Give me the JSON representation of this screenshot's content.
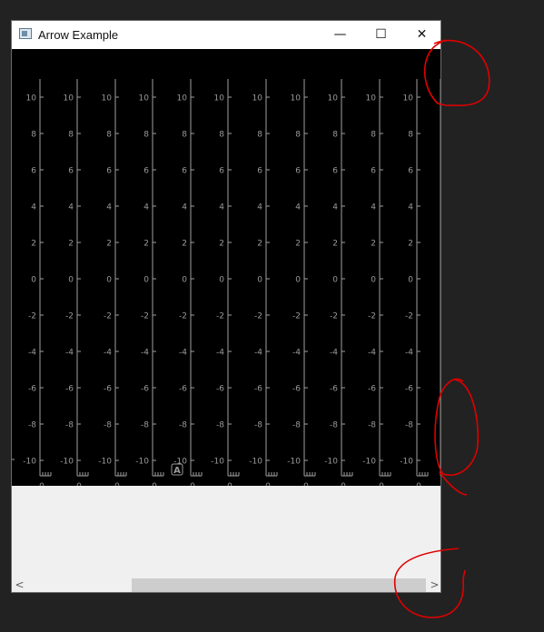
{
  "window": {
    "title": "Arrow Example",
    "controls": {
      "minimize": "—",
      "maximize": "☐",
      "close": "✕"
    }
  },
  "plot": {
    "y_tick_labels": [
      "10",
      "8",
      "6",
      "4",
      "2",
      "0",
      "-2",
      "-4",
      "-6",
      "-8",
      "-10"
    ],
    "x_tick_label": "0",
    "marker_label": "A",
    "axis_color": "#a0a0a0",
    "label_color": "#9a9a9a",
    "background": "#000000"
  },
  "scrollbar": {
    "left_arrow": "<",
    "right_arrow": ">"
  },
  "annotation": {
    "color": "#e00000"
  }
}
